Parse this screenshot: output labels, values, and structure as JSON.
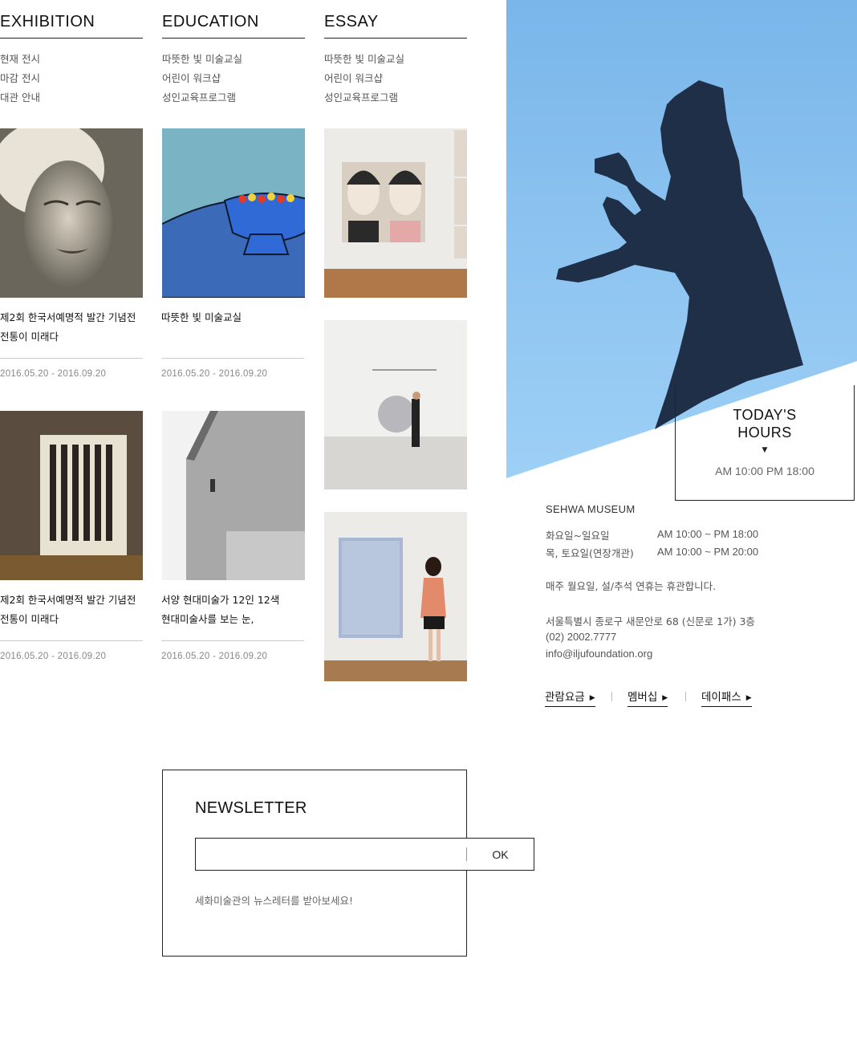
{
  "columns": [
    {
      "heading": "EXHIBITION",
      "links": [
        "현재 전시",
        "마감 전시",
        "대관 안내"
      ]
    },
    {
      "heading": "EDUCATION",
      "links": [
        "따뜻한 빛 미술교실",
        "어린이 워크샵",
        "성인교육프로그램"
      ]
    },
    {
      "heading": "ESSAY",
      "links": [
        "따뜻한 빛 미술교실",
        "어린이 워크샵",
        "성인교육프로그램"
      ]
    }
  ],
  "cards": {
    "exhibition": [
      {
        "title_line1": "제2회 한국서예명적 발간 기념전",
        "title_line2": "전통이 미래다",
        "date": "2016.05.20 - 2016.09.20"
      },
      {
        "title_line1": "제2회 한국서예명적 발간 기념전",
        "title_line2": "전통이 미래다",
        "date": "2016.05.20 - 2016.09.20"
      }
    ],
    "education": [
      {
        "title_line1": "따뜻한 빛 미술교실",
        "title_line2": "",
        "date": "2016.05.20 - 2016.09.20"
      },
      {
        "title_line1": "서양 현대미술가 12인 12색",
        "title_line2": "현대미술사를 보는 눈,",
        "date": "2016.05.20 - 2016.09.20"
      }
    ]
  },
  "hours": {
    "title_line1": "TODAY'S",
    "title_line2": "HOURS",
    "arrow": "▼",
    "time": "AM 10:00 PM 18:00"
  },
  "museum": {
    "name": "SEHWA MUSEUM",
    "schedule": [
      {
        "days": "화요일~일요일",
        "time": "AM 10:00 ~ PM 18:00"
      },
      {
        "days": "목, 토요일(연장개관)",
        "time": "AM 10:00 ~ PM 20:00"
      }
    ],
    "closed_notice": "매주 월요일, 설/추석 연휴는 휴관합니다.",
    "address": "서울특별시 종로구 새문안로 68 (신문로 1가) 3층",
    "phone": "(02) 2002.7777",
    "email": "info@iljufoundation.org"
  },
  "quick_links": [
    "관람요금",
    "멤버십",
    "데이패스"
  ],
  "newsletter": {
    "title": "NEWSLETTER",
    "input_placeholder": "",
    "button_label": "OK",
    "description": "세화미술관의 뉴스레터를 받아보세요!"
  },
  "colors": {
    "sky": "#8ec4ee",
    "sculpture": "#1f2f48",
    "rule": "#222222",
    "muted": "#888888"
  }
}
